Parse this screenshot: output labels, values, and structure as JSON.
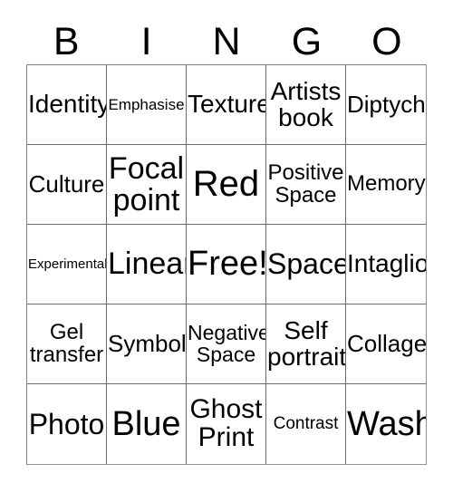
{
  "card": {
    "title": "BINGO",
    "header_letters": [
      "B",
      "I",
      "N",
      "G",
      "O"
    ],
    "background_color": "#ffffff",
    "text_color": "#000000",
    "border_color": "#6b6b6b",
    "grid_size": "5x5",
    "cells": [
      {
        "text": "Identity",
        "size_class": "fs-28"
      },
      {
        "text": "Emphasise",
        "size_class": "fs-17"
      },
      {
        "text": "Texture",
        "size_class": "fs-28"
      },
      {
        "text": "Artists\nbook",
        "size_class": "fs-28"
      },
      {
        "text": "Diptych",
        "size_class": "fs-26"
      },
      {
        "text": "Culture",
        "size_class": "fs-26"
      },
      {
        "text": "Focal\npoint",
        "size_class": "fs-34"
      },
      {
        "text": "Red",
        "size_class": "fs-40"
      },
      {
        "text": "Positive\nSpace",
        "size_class": "fs-24"
      },
      {
        "text": "Memory",
        "size_class": "fs-24"
      },
      {
        "text": "Experimental",
        "size_class": "fs-15"
      },
      {
        "text": "Linear",
        "size_class": "fs-34"
      },
      {
        "text": "Free!",
        "size_class": "fs-38"
      },
      {
        "text": "Space",
        "size_class": "fs-32"
      },
      {
        "text": "Intaglio",
        "size_class": "fs-28"
      },
      {
        "text": "Gel\ntransfer",
        "size_class": "fs-24"
      },
      {
        "text": "Symbol",
        "size_class": "fs-26"
      },
      {
        "text": "Negative\nSpace",
        "size_class": "fs-23"
      },
      {
        "text": "Self\nportrait",
        "size_class": "fs-28"
      },
      {
        "text": "Collage",
        "size_class": "fs-26"
      },
      {
        "text": "Photo",
        "size_class": "fs-32"
      },
      {
        "text": "Blue",
        "size_class": "fs-38"
      },
      {
        "text": "Ghost\nPrint",
        "size_class": "fs-30"
      },
      {
        "text": "Contrast",
        "size_class": "fs-19"
      },
      {
        "text": "Wash",
        "size_class": "fs-38"
      }
    ]
  }
}
